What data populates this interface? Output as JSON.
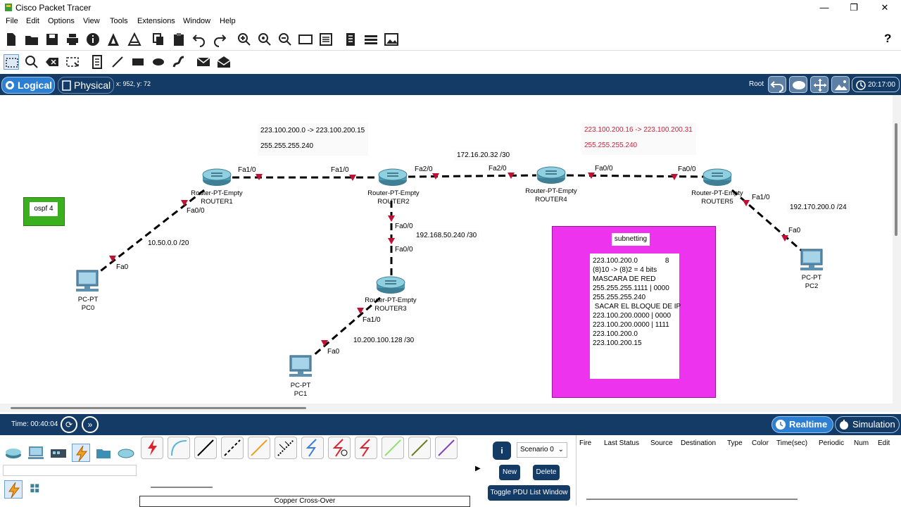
{
  "window": {
    "title": "Cisco Packet Tracer",
    "controls": [
      "—",
      "❐",
      "✕"
    ]
  },
  "menu": [
    "File",
    "Edit",
    "Options",
    "View",
    "Tools",
    "Extensions",
    "Window",
    "Help"
  ],
  "toolbar_help": "?",
  "nav": {
    "logical_label": "Logical",
    "physical_label": "Physical",
    "coords": "x: 952, y: 72",
    "root_label": "Root",
    "clock": "20:17:00"
  },
  "workspace": {
    "ospf_note": "ospf 4",
    "note1_line1": "223.100.200.0 -> 223.100.200.15",
    "note1_line2": "255.255.255.240",
    "note2_line1": "223.100.200.16 -> 223.100.200.31",
    "note2_line2": "255.255.255.240",
    "subnet_r2_r4": "172.16.20.32  /30",
    "subnet_r2_r3": "192.168.50.240  /30",
    "subnet_pc0": "10.50.0.0  /20",
    "subnet_pc1": "10.200.100.128  /30",
    "subnet_pc2": "192.170.200.0  /24",
    "colors": {
      "note2_text": "#d0203a",
      "subnet_area": "#ee33ee",
      "ospf_area": "#3ab01e"
    },
    "devices": {
      "router1": {
        "model": "Router-PT-Empty",
        "name": "ROUTER1"
      },
      "router2": {
        "model": "Router-PT-Empty",
        "name": "ROUTER2"
      },
      "router3": {
        "model": "Router-PT-Empty",
        "name": "ROUTER3"
      },
      "router4": {
        "model": "Router-PT-Empty",
        "name": "ROUTER4"
      },
      "router5": {
        "model": "Router-PT-Empty",
        "name": "ROUTER5"
      },
      "pc0": {
        "model": "PC-PT",
        "name": "PC0"
      },
      "pc1": {
        "model": "PC-PT",
        "name": "PC1"
      },
      "pc2": {
        "model": "PC-PT",
        "name": "PC2"
      }
    },
    "ports": {
      "r1_fa10": "Fa1/0",
      "r1_fa00": "Fa0/0",
      "r2_fa10": "Fa1/0",
      "r2_fa20": "Fa2/0",
      "r2_fa00": "Fa0/0",
      "r4_fa20": "Fa2/0",
      "r4_fa00": "Fa0/0",
      "r5_fa00": "Fa0/0",
      "r5_fa10": "Fa1/0",
      "r3_fa00": "Fa0/0",
      "r3_fa10": "Fa1/0",
      "pc0_fa0": "Fa0",
      "pc1_fa0": "Fa0",
      "pc2_fa0": "Fa0"
    },
    "subnetting": {
      "title": "subnetting",
      "lines": [
        "223.100.200.0              8",
        "(8)10 -> (8)2 = 4 bits",
        "",
        "MASCARA DE RED",
        "255.255.255.1111 | 0000",
        "255.255.255.240",
        "",
        " SACAR EL BLOQUE DE IP",
        "223.100.200.0000 | 0000",
        "223.100.200.0000 | 1111",
        "",
        "223.100.200.0",
        "223.100.200.15"
      ]
    }
  },
  "bottom": {
    "time": "Time: 00:40:04",
    "realtime": "Realtime",
    "simulation": "Simulation",
    "connection_label": "Copper Cross-Over",
    "scenario": "Scenario 0",
    "new_label": "New",
    "delete_label": "Delete",
    "toggle_label": "Toggle PDU List Window",
    "info": "i",
    "table_headers": [
      "Fire",
      "Last Status",
      "Source",
      "Destination",
      "Type",
      "Color",
      "Time(sec)",
      "Periodic",
      "Num",
      "Edit"
    ]
  }
}
